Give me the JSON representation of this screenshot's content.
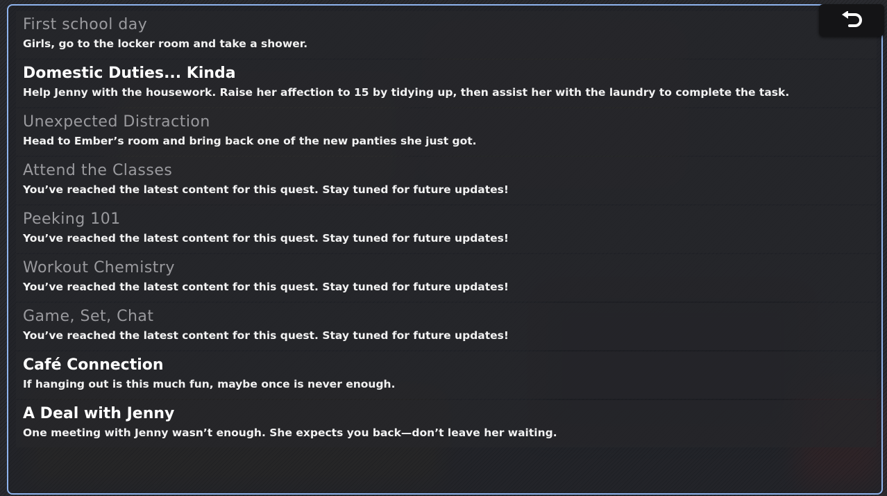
{
  "quests": [
    {
      "title": "First school day",
      "description": "Girls, go to the locker room and take a shower.",
      "state": "done"
    },
    {
      "title": "Domestic Duties... Kinda",
      "description": "Help Jenny with the housework. Raise her affection to 15 by tidying up, then assist her with the laundry to complete the task.",
      "state": "active"
    },
    {
      "title": "Unexpected Distraction",
      "description": "Head to Ember’s room and bring back one of the new panties she just got.",
      "state": "done"
    },
    {
      "title": "Attend the Classes",
      "description": "You’ve reached the latest content for this quest. Stay tuned for future updates!",
      "state": "done"
    },
    {
      "title": "Peeking 101",
      "description": "You’ve reached the latest content for this quest. Stay tuned for future updates!",
      "state": "done"
    },
    {
      "title": "Workout Chemistry",
      "description": "You’ve reached the latest content for this quest. Stay tuned for future updates!",
      "state": "done"
    },
    {
      "title": "Game, Set, Chat",
      "description": "You’ve reached the latest content for this quest. Stay tuned for future updates!",
      "state": "done"
    },
    {
      "title": "Café Connection",
      "description": "If hanging out is this much fun, maybe once is never enough.",
      "state": "active"
    },
    {
      "title": "A Deal with Jenny",
      "description": "One meeting with Jenny wasn’t enough. She expects you back—don’t leave her waiting.",
      "state": "active"
    }
  ],
  "back_button": {
    "icon": "undo-arrow-icon"
  },
  "colors": {
    "frame_border": "#8fb4ee",
    "active_title": "#ffffff",
    "done_title": "#9a9a9e"
  }
}
